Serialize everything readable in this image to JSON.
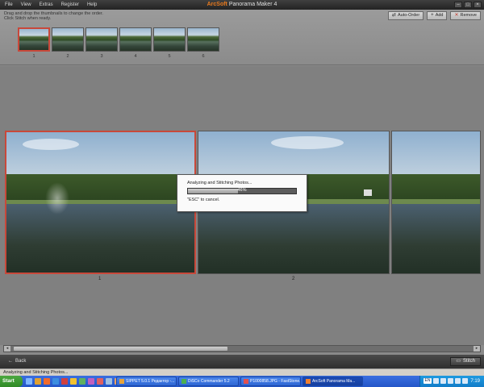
{
  "app": {
    "brand": "ArcSoft",
    "title_rest": " Panorama Maker 4",
    "menu": [
      "File",
      "View",
      "Extras",
      "Register",
      "Help"
    ]
  },
  "thumb_panel": {
    "instruction_line1": "Drag and drop the thumbnails to change the order.",
    "instruction_line2": "Click Stitch when ready.",
    "buttons": {
      "auto_order": "Auto-Order",
      "add": "Add",
      "remove": "Remove"
    },
    "thumbnails": [
      "1",
      "2",
      "3",
      "4",
      "5",
      "6"
    ],
    "selected_index": 0
  },
  "viewer": {
    "photos": [
      {
        "label": "1",
        "selected": true
      },
      {
        "label": "2",
        "selected": false
      },
      {
        "label": "",
        "selected": false
      }
    ]
  },
  "dialog": {
    "title": "Analyzing and Stitching Photos...",
    "progress_text": "46%",
    "progress": 0.46,
    "cancel_hint": "\"ESC\" to cancel."
  },
  "bottombar": {
    "back_label": "Back",
    "stitch_label": "Stitch"
  },
  "status": "Analyzing and Stitching Photos...",
  "taskbar": {
    "start": "Start",
    "tasks": [
      {
        "label": "SIPPET 5.0.1 Редактор -..."
      },
      {
        "label": "DiSCo Commander 5.2"
      },
      {
        "label": "P1000858.JPG - FastStone..."
      },
      {
        "label": "ArcSoft Panorama Ma...",
        "active": true
      }
    ],
    "tray_label": "EN",
    "time": "7:19"
  }
}
